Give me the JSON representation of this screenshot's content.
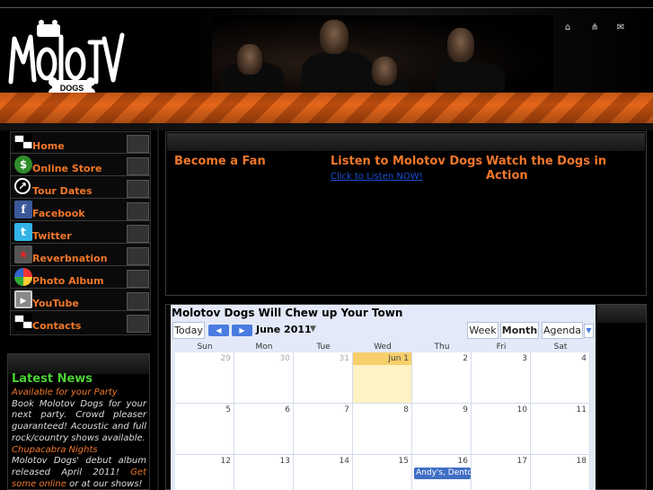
{
  "header": {
    "logo_text": "Molotov",
    "logo_sub": "DOGS",
    "icons": [
      "home-icon",
      "sitemap-icon",
      "mail-icon"
    ]
  },
  "nav": {
    "items": [
      {
        "label": "Home",
        "icon": "dog-icon"
      },
      {
        "label": "Online Store",
        "icon": "dollar-icon"
      },
      {
        "label": "Tour Dates",
        "icon": "clock-icon"
      },
      {
        "label": "Facebook",
        "icon": "facebook-icon"
      },
      {
        "label": "Twitter",
        "icon": "twitter-icon"
      },
      {
        "label": "Reverbnation",
        "icon": "reverbnation-icon"
      },
      {
        "label": "Photo Album",
        "icon": "photo-icon"
      },
      {
        "label": "YouTube",
        "icon": "youtube-icon"
      },
      {
        "label": "Contacts",
        "icon": "dog-icon"
      }
    ]
  },
  "news": {
    "title": "Latest News",
    "item1_head": "Available for your Party",
    "item1_body": "Book Molotov Dogs for your next party. Crowd pleaser guaranteed! Acoustic and full rock/country shows available.",
    "item2_head": "Chupacabra Nights",
    "item2_body": "Molotov Dogs' debut album released April 2011!",
    "item2_link": "Get some online",
    "item2_tail": "or at our shows!"
  },
  "columns": {
    "fan_title": "Become a Fan",
    "listen_title": "Listen to Molotov Dogs",
    "listen_link": "Click to Listen NOW!",
    "watch_title": "Watch the Dogs in Action"
  },
  "calendar": {
    "title": "Molotov Dogs Will Chew up Your Town",
    "today_label": "Today",
    "month_label": "June 2011",
    "view_week": "Week",
    "view_month": "Month",
    "view_agenda": "Agenda",
    "days_of_week": [
      "Sun",
      "Mon",
      "Tue",
      "Wed",
      "Thu",
      "Fri",
      "Sat"
    ],
    "weeks": [
      [
        "29",
        "30",
        "31",
        "Jun 1",
        "2",
        "3",
        "4"
      ],
      [
        "5",
        "6",
        "7",
        "8",
        "9",
        "10",
        "11"
      ],
      [
        "12",
        "13",
        "14",
        "15",
        "16",
        "17",
        "18"
      ]
    ],
    "event_label": "Andy's, Dento"
  },
  "colors": {
    "accent_orange": "#f0772a",
    "news_green": "#4cd236",
    "link_blue": "#1a4fd6",
    "event_blue": "#3f6ec5",
    "today_yellow": "#fff3c4"
  }
}
